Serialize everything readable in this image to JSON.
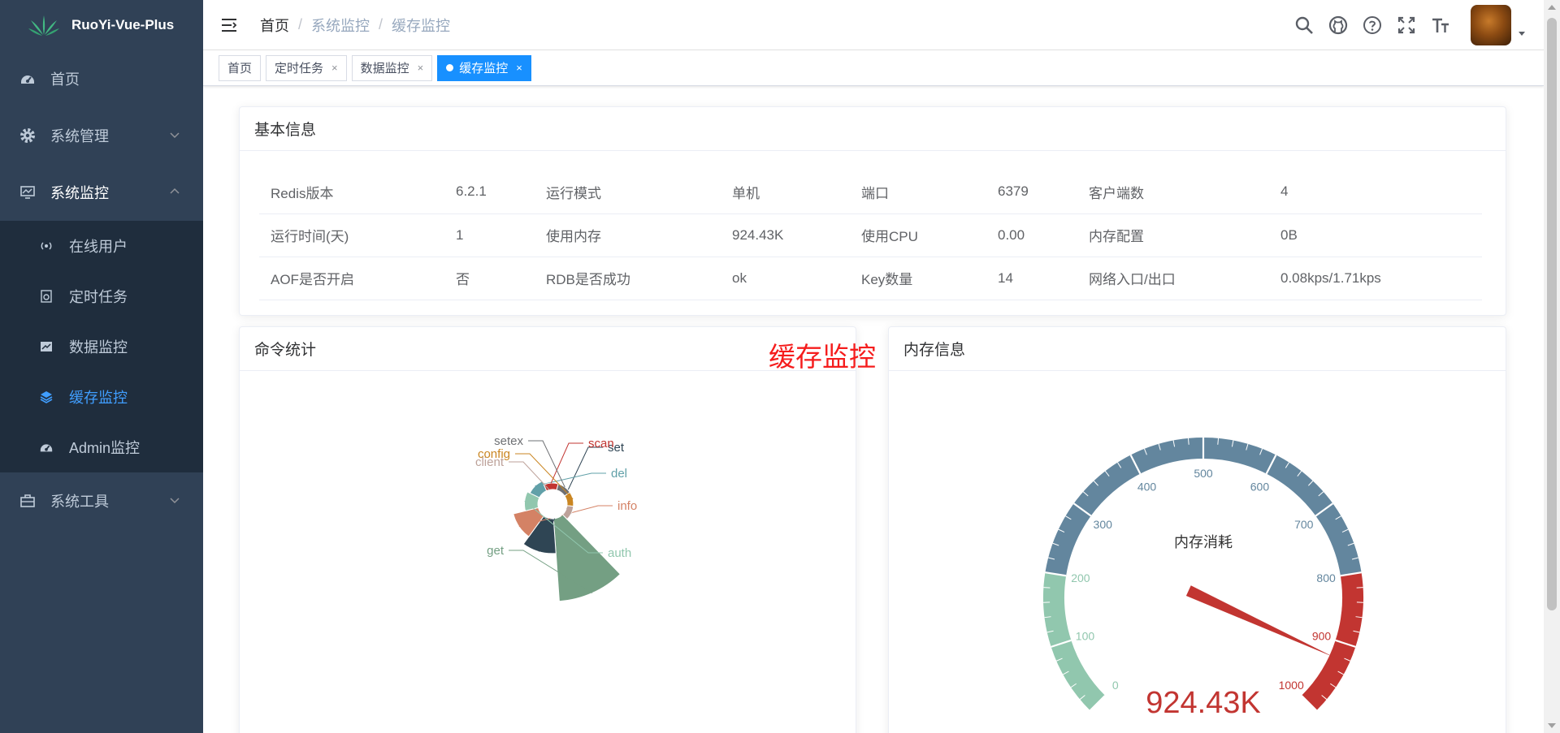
{
  "app": {
    "title": "RuoYi-Vue-Plus"
  },
  "sidebar": {
    "items": [
      {
        "label": "首页"
      },
      {
        "label": "系统管理"
      },
      {
        "label": "系统监控"
      },
      {
        "label": "系统工具"
      }
    ],
    "monitor_sub": [
      {
        "label": "在线用户"
      },
      {
        "label": "定时任务"
      },
      {
        "label": "数据监控"
      },
      {
        "label": "缓存监控"
      },
      {
        "label": "Admin监控"
      }
    ]
  },
  "breadcrumb": [
    "首页",
    "/",
    "系统监控",
    "/",
    "缓存监控"
  ],
  "tags": [
    {
      "label": "首页"
    },
    {
      "label": "定时任务",
      "close": "×"
    },
    {
      "label": "数据监控",
      "close": "×"
    },
    {
      "label": "缓存监控",
      "close": "×"
    }
  ],
  "basic": {
    "title": "基本信息",
    "rows": [
      [
        "Redis版本",
        "6.2.1",
        "运行模式",
        "单机",
        "端口",
        "6379",
        "客户端数",
        "4"
      ],
      [
        "运行时间(天)",
        "1",
        "使用内存",
        "924.43K",
        "使用CPU",
        "0.00",
        "内存配置",
        "0B"
      ],
      [
        "AOF是否开启",
        "否",
        "RDB是否成功",
        "ok",
        "Key数量",
        "14",
        "网络入口/出口",
        "0.08kps/1.71kps"
      ]
    ]
  },
  "overlay_title": "缓存监控",
  "cmd": {
    "title": "命令统计"
  },
  "mem": {
    "title": "内存信息"
  },
  "chart_data": [
    {
      "type": "pie",
      "rose": true,
      "categories": [
        "get",
        "set",
        "info",
        "auth",
        "del",
        "scan",
        "setex",
        "config",
        "client"
      ],
      "values": [
        100,
        18,
        10,
        3,
        2,
        1,
        1,
        1,
        1
      ],
      "colors": [
        "#749f83",
        "#2f4554",
        "#d48265",
        "#91c7ae",
        "#61a0a8",
        "#c23531",
        "#6e7074",
        "#ca8622",
        "#bda29a"
      ]
    },
    {
      "type": "gauge",
      "title": "内存消耗",
      "min": 0,
      "max": 1000,
      "value": 924.43,
      "value_label": "924.43K",
      "ticks": [
        "0",
        "100",
        "200",
        "300",
        "400",
        "500",
        "600",
        "700",
        "800",
        "900",
        "1000"
      ],
      "bands": [
        {
          "to": 0.2,
          "color": "#91c7ae"
        },
        {
          "to": 0.8,
          "color": "#63869e"
        },
        {
          "to": 1.0,
          "color": "#c23531"
        }
      ]
    }
  ]
}
